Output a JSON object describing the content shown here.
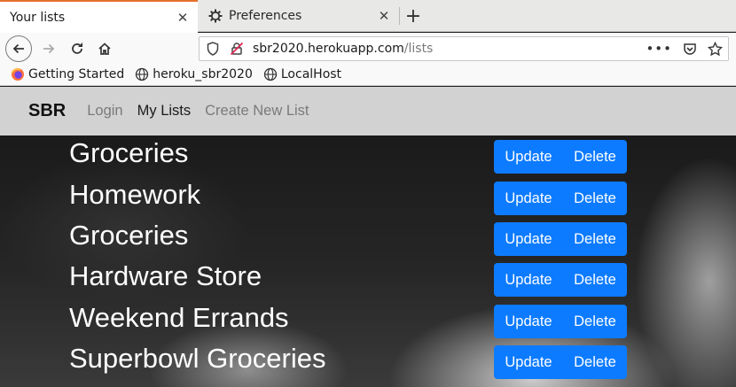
{
  "browser": {
    "tabs": [
      {
        "label": "Your lists",
        "active": true
      },
      {
        "label": "Preferences",
        "active": false,
        "icon": "gear-icon"
      }
    ],
    "url": {
      "host": "sbr2020.herokuapp.com",
      "path": "/lists"
    },
    "bookmarks": [
      {
        "label": "Getting Started",
        "icon": "firefox-icon"
      },
      {
        "label": "heroku_sbr2020",
        "icon": "globe-icon"
      },
      {
        "label": "LocalHost",
        "icon": "globe-icon"
      }
    ]
  },
  "site": {
    "brand": "SBR",
    "nav": [
      {
        "label": "Login",
        "active": false
      },
      {
        "label": "My Lists",
        "active": true
      },
      {
        "label": "Create New List",
        "active": false
      }
    ]
  },
  "lists": [
    {
      "name": "Groceries",
      "update_label": "Update",
      "delete_label": "Delete"
    },
    {
      "name": "Homework",
      "update_label": "Update",
      "delete_label": "Delete"
    },
    {
      "name": "Groceries",
      "update_label": "Update",
      "delete_label": "Delete"
    },
    {
      "name": "Hardware Store",
      "update_label": "Update",
      "delete_label": "Delete"
    },
    {
      "name": "Weekend Errands",
      "update_label": "Update",
      "delete_label": "Delete"
    },
    {
      "name": "Superbowl Groceries",
      "update_label": "Update",
      "delete_label": "Delete"
    }
  ],
  "colors": {
    "accent_tab": "#e5702a",
    "button": "#0d7bff",
    "site_nav_bg": "#d2d2d2"
  }
}
